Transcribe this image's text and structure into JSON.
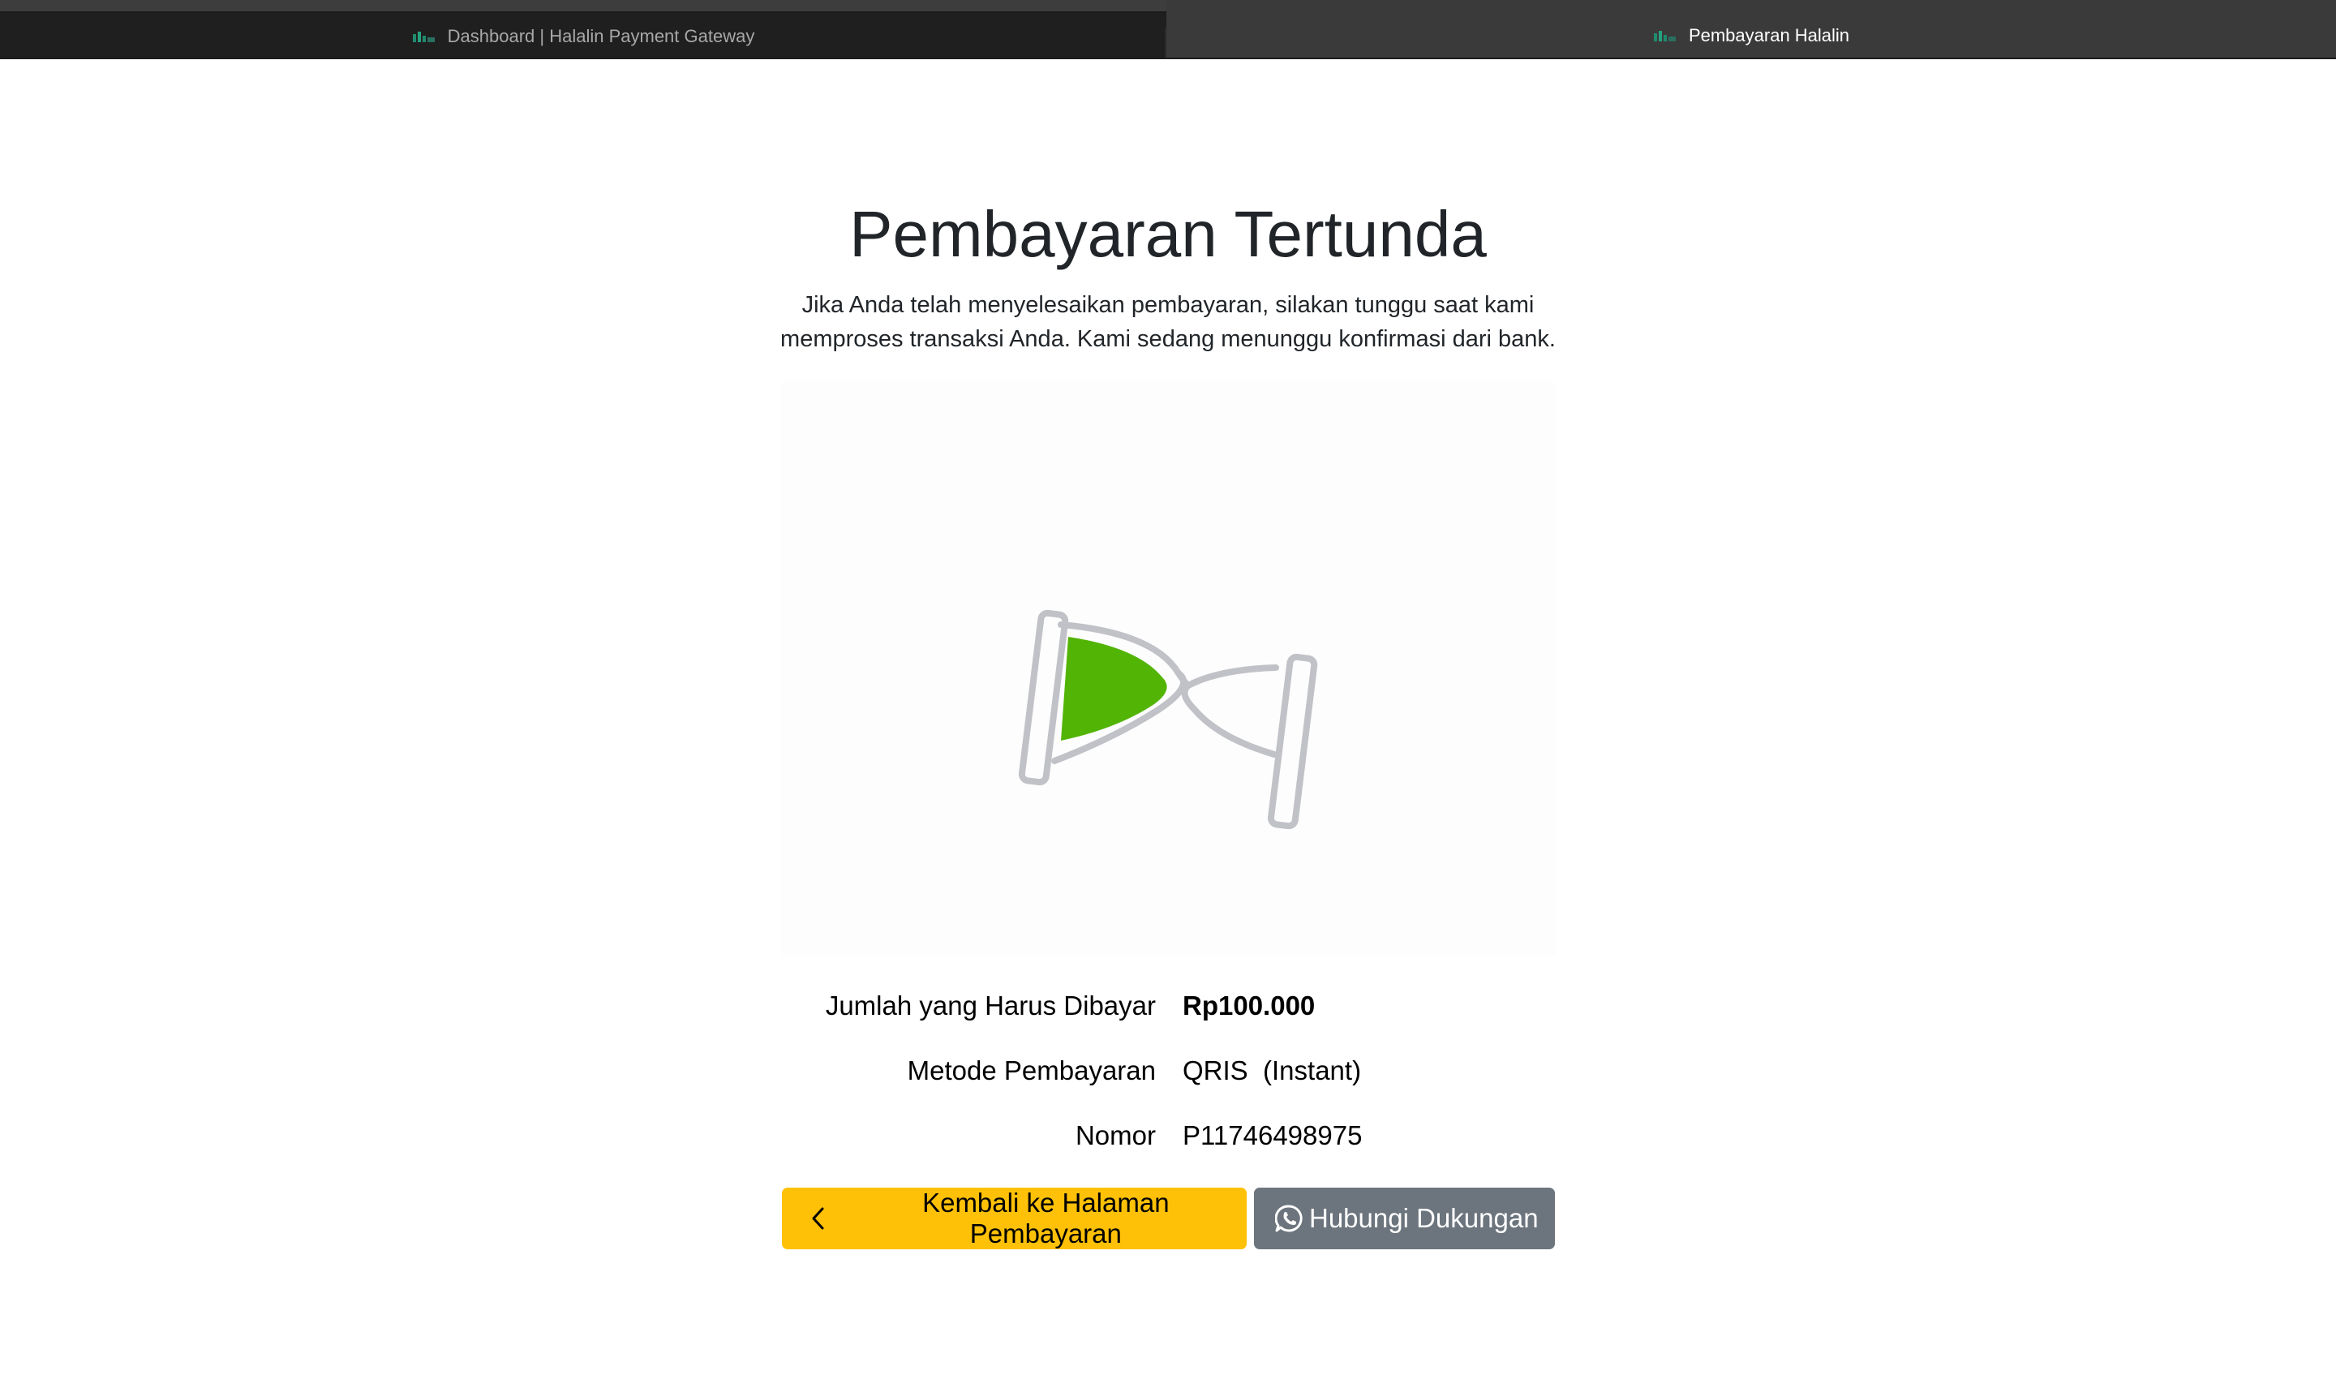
{
  "browser": {
    "tabs": [
      {
        "title": "Dashboard | Halalin Payment Gateway",
        "active": false,
        "favicon": "halalin-logo-icon"
      },
      {
        "title": "Pembayaran Halalin",
        "active": true,
        "favicon": "halalin-logo-icon"
      }
    ]
  },
  "page": {
    "title": "Pembayaran Tertunda",
    "subtitle_line1": "Jika Anda telah menyelesaikan pembayaran, silakan tunggu saat kami",
    "subtitle_line2": "memproses transaksi Anda. Kami sedang menunggu konfirmasi dari bank.",
    "illustration": "hourglass-icon"
  },
  "details": {
    "amount_label": "Jumlah yang Harus Dibayar",
    "amount_value": "Rp100.000",
    "method_label": "Metode Pembayaran",
    "method_value": "QRIS  (Instant)",
    "number_label": "Nomor",
    "number_value": "P11746498975"
  },
  "actions": {
    "back_label": "Kembali ke Halaman Pembayaran",
    "back_icon": "chevron-left-icon",
    "support_label": "Hubungi Dukungan",
    "support_icon": "whatsapp-icon"
  },
  "colors": {
    "primary_yellow": "#ffc107",
    "secondary_gray": "#6c757d",
    "sand_green": "#52b404",
    "hourglass_frame": "#c0c2c7"
  }
}
